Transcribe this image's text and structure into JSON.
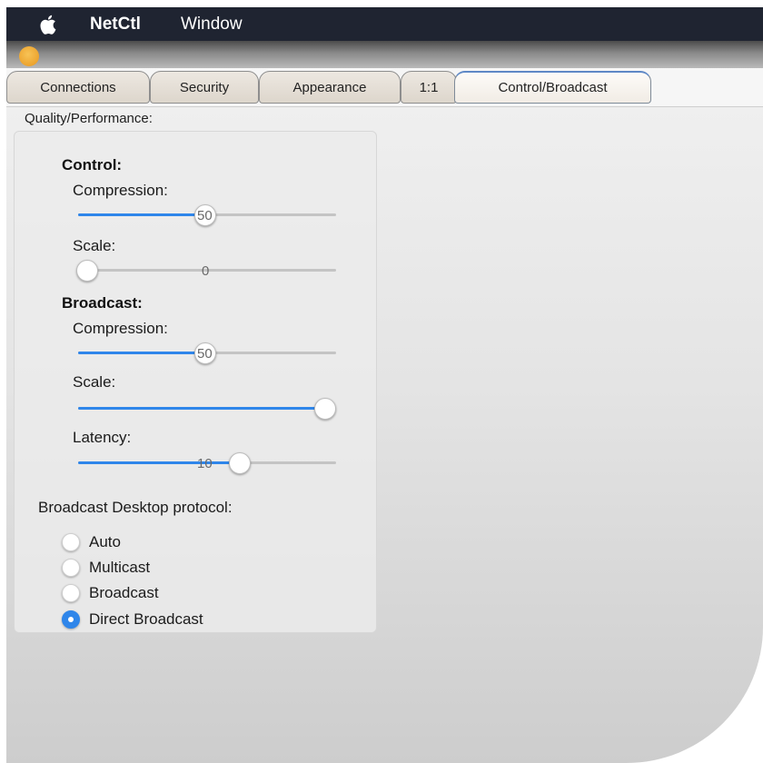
{
  "menubar": {
    "app_name": "NetCtl",
    "window_menu": "Window"
  },
  "tabs": [
    {
      "label": "Connections",
      "active": false
    },
    {
      "label": "Security",
      "active": false
    },
    {
      "label": "Appearance",
      "active": false
    },
    {
      "label": "1:1",
      "active": false
    },
    {
      "label": "Control/Broadcast",
      "active": true
    }
  ],
  "section_title": "Quality/Performance:",
  "control": {
    "heading": "Control:",
    "compression": {
      "label": "Compression:",
      "value": "50"
    },
    "scale": {
      "label": "Scale:",
      "value": "0"
    }
  },
  "broadcast": {
    "heading": "Broadcast:",
    "compression": {
      "label": "Compression:",
      "value": "50"
    },
    "scale": {
      "label": "Scale:"
    },
    "latency": {
      "label": "Latency:",
      "value": "10"
    }
  },
  "protocol": {
    "label": "Broadcast Desktop protocol:",
    "options": [
      "Auto",
      "Multicast",
      "Broadcast",
      "Direct Broadcast"
    ],
    "selected": "Direct Broadcast"
  },
  "colors": {
    "accent": "#2f86ea",
    "menubar": "#1f2431",
    "traffic_light": "#eda42f"
  }
}
